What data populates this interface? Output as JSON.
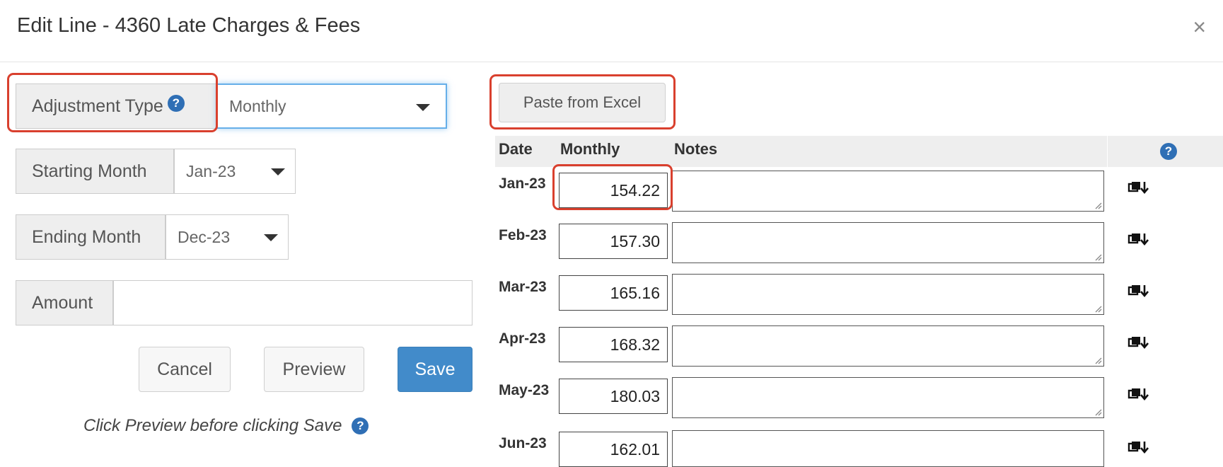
{
  "dialog": {
    "title": "Edit Line - 4360 Late Charges & Fees",
    "close_icon": "close-icon"
  },
  "form": {
    "adjustment_type": {
      "label": "Adjustment Type",
      "value": "Monthly"
    },
    "starting_month": {
      "label": "Starting Month",
      "value": "Jan-23"
    },
    "ending_month": {
      "label": "Ending Month",
      "value": "Dec-23"
    },
    "amount": {
      "label": "Amount",
      "value": ""
    },
    "buttons": {
      "cancel": "Cancel",
      "preview": "Preview",
      "save": "Save"
    },
    "hint": "Click Preview before clicking Save"
  },
  "table": {
    "paste_button": "Paste from Excel",
    "headers": {
      "date": "Date",
      "monthly": "Monthly",
      "notes": "Notes"
    },
    "rows": [
      {
        "date": "Jan-23",
        "amount": "154.22",
        "notes": ""
      },
      {
        "date": "Feb-23",
        "amount": "157.30",
        "notes": ""
      },
      {
        "date": "Mar-23",
        "amount": "165.16",
        "notes": ""
      },
      {
        "date": "Apr-23",
        "amount": "168.32",
        "notes": ""
      },
      {
        "date": "May-23",
        "amount": "180.03",
        "notes": ""
      },
      {
        "date": "Jun-23",
        "amount": "162.01",
        "notes": ""
      }
    ]
  },
  "colors": {
    "primary": "#428bca",
    "help_icon": "#2f6fb5",
    "annotation": "#d9402e"
  }
}
